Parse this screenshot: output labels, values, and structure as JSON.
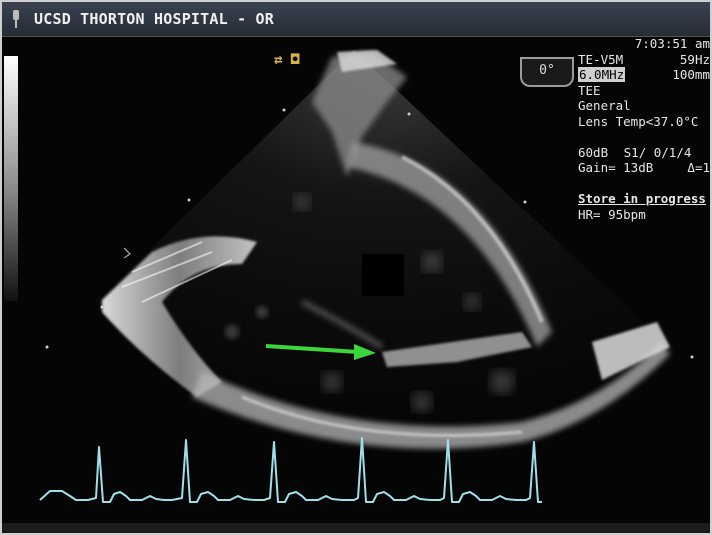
{
  "header": {
    "title": "UCSD THORTON HOSPITAL - OR"
  },
  "info_panel": {
    "time": "7:03:51 am",
    "probe": "TE-V5M",
    "frame_rate": "59Hz",
    "frequency": "6.0MHz",
    "depth": "100mm",
    "mode": "TEE",
    "preset": "General",
    "lens_temp": "Lens Temp<37.0°C",
    "dynamic_range": "60dB",
    "settings": "S1/ 0/1/4",
    "gain": "Gain= 13dB",
    "delta": "Δ=1",
    "store_status": "Store in progress",
    "heart_rate": "HR= 95bpm"
  },
  "probe_angle": "0°",
  "colors": {
    "ecg_trace": "#9fe0e8",
    "arrow": "#3cd63c",
    "marker": "#d9b449"
  }
}
